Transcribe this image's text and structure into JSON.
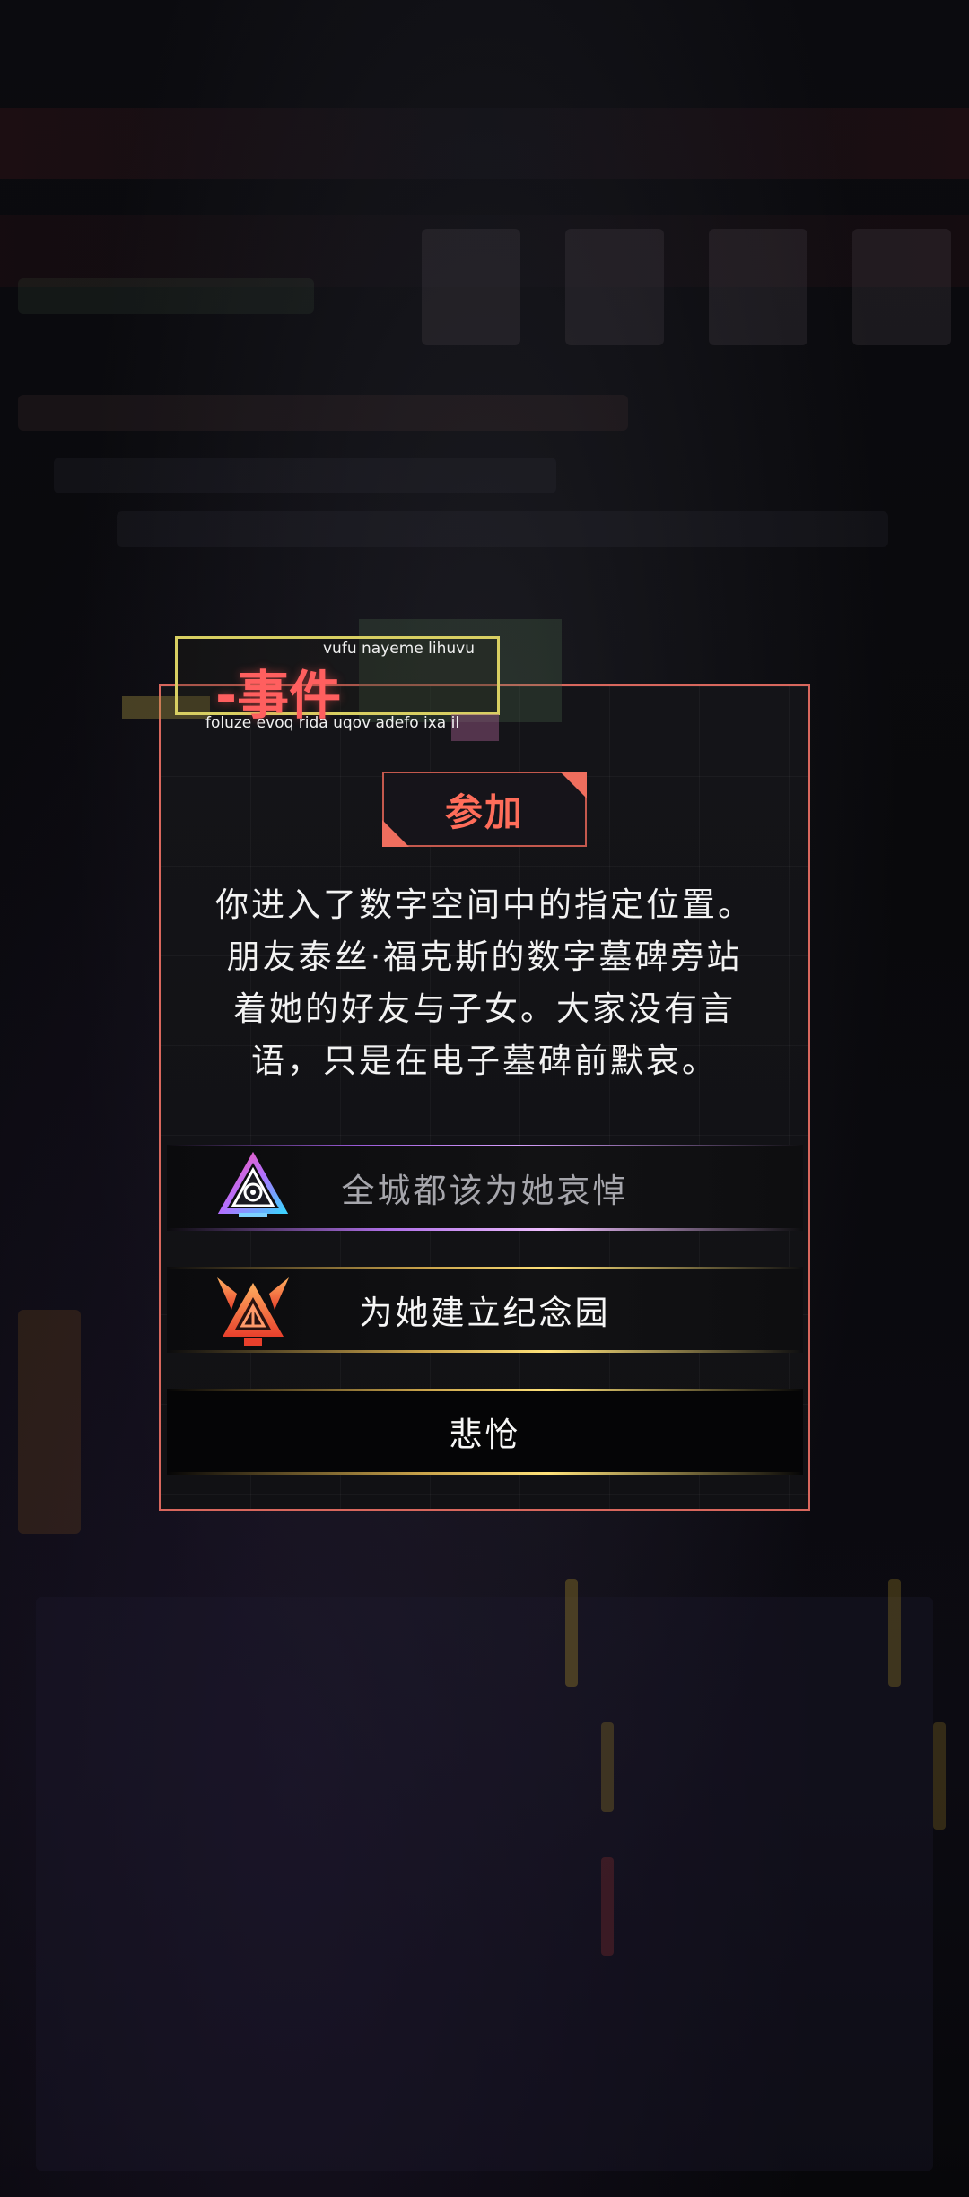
{
  "event": {
    "title": "-事件",
    "title_top_text": "vufu nayeme lihuvu",
    "title_bottom_text": "foluze evoq rida uqov adefo ixa il"
  },
  "badge": {
    "label": "参加"
  },
  "description": {
    "lines": [
      "你进入了数字空间中的指定位置。",
      "朋友泰丝·福克斯的数字墓碑旁站",
      "着她的好友与子女。大家没有言",
      "语，只是在电子墓碑前默哀。"
    ]
  },
  "options": [
    {
      "label": "全城都该为她哀悼",
      "icon": "triangle-eye-emblem-icon",
      "accent": "#b070e8",
      "enabled": false
    },
    {
      "label": "为她建立纪念园",
      "icon": "winged-triangle-emblem-icon",
      "accent": "#e0b84a",
      "enabled": true
    },
    {
      "label": "悲怆",
      "icon": "",
      "accent": "#e0b84a",
      "enabled": true
    }
  ],
  "colors": {
    "frame_border": "#d8675d",
    "title_red": "#ff5f5f",
    "title_box_yellow": "#d8cf62",
    "badge_red": "#ff6d5a"
  }
}
